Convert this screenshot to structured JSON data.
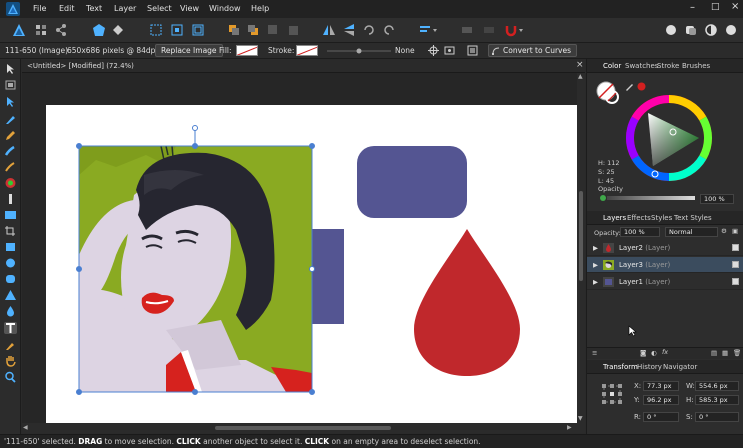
{
  "menu": [
    "File",
    "Edit",
    "Text",
    "Layer",
    "Select",
    "View",
    "Window",
    "Help"
  ],
  "context_bar": {
    "selection_name": "111-650 (Image)",
    "image_info": "650x686 pixels @ 84dpi",
    "replace_image": "Replace Image",
    "fill_label": "Fill:",
    "stroke_label": "Stroke:",
    "stroke_value": "None",
    "convert_to_curves": "Convert to Curves"
  },
  "document": {
    "tab_title": "<Untitled> [Modified] (72.4%)",
    "close_glyph": "×"
  },
  "color_panel": {
    "tabs": [
      "Color",
      "Swatches",
      "Stroke",
      "Brushes"
    ],
    "h": "H: 112",
    "s": "S: 25",
    "l": "L: 45",
    "opacity_label": "Opacity",
    "opacity_value": "100 %",
    "colors": {
      "wheel_fill": "#3fa84a",
      "active_color": "#d32020"
    }
  },
  "layers_panel": {
    "tabs": [
      "Layers",
      "Effects",
      "Styles",
      "Text Styles"
    ],
    "opacity_label": "Opacity:",
    "opacity_value": "100 %",
    "blend_mode": "Normal",
    "layers": [
      {
        "name": "Layer2",
        "kind": "(Layer)"
      },
      {
        "name": "Layer3",
        "kind": "(Layer)"
      },
      {
        "name": "Layer1",
        "kind": "(Layer)"
      }
    ],
    "fx_label": "fx"
  },
  "transform_panel": {
    "tabs": [
      "Transform",
      "History",
      "Navigator"
    ],
    "x_label": "X:",
    "x_value": "77.3 px",
    "y_label": "Y:",
    "y_value": "96.2 px",
    "w_label": "W:",
    "w_value": "554.6 px",
    "h_label": "H:",
    "h_value": "585.3 px",
    "r_label": "R:",
    "r_value": "0 °",
    "s_label": "S:",
    "s_value": "0 °"
  },
  "status": {
    "part1": "'111-650' selected. ",
    "drag": "DRAG",
    "part2": " to move selection. ",
    "click1": "CLICK",
    "part3": " another object to select it. ",
    "click2": "CLICK",
    "part4": " on an empty area to deselect selection."
  },
  "colors": {
    "rect_purple": "#545592",
    "drop_red": "#c0282c",
    "portrait_green": "#8aaa22",
    "selection_blue": "#4a7fd1"
  }
}
